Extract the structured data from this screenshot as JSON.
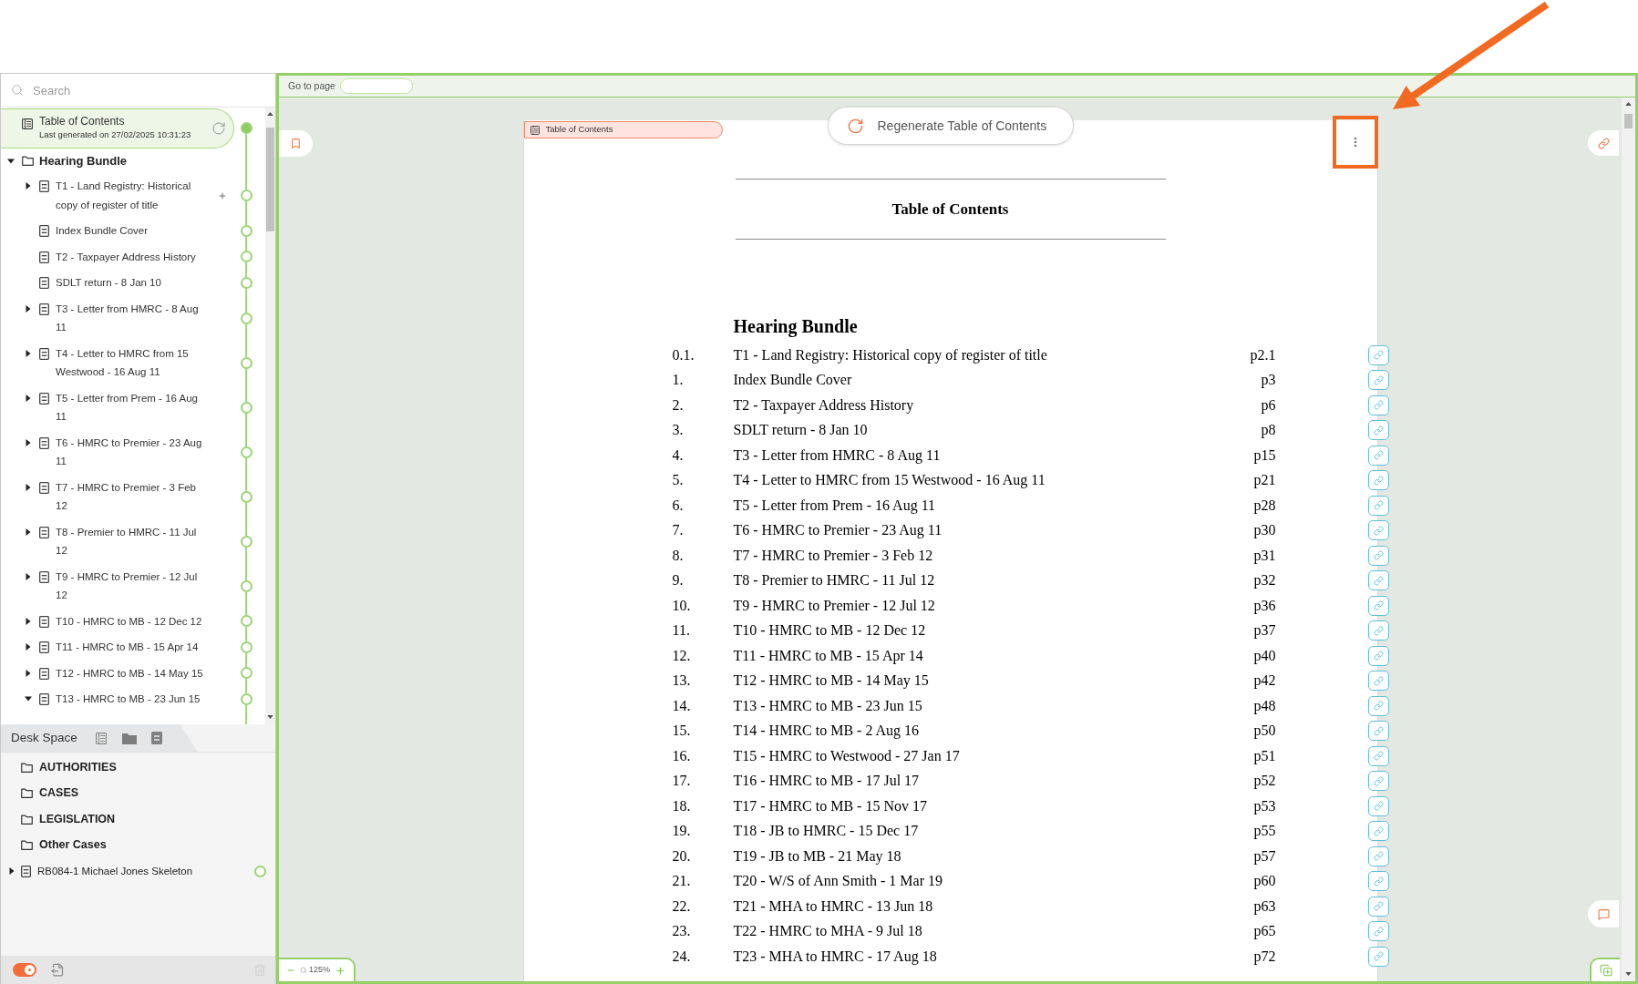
{
  "sidebar": {
    "search": {
      "placeholder": "Search"
    },
    "toc_entry": {
      "title": "Table of Contents",
      "subtitle": "Last generated on 27/02/2025 10:31:23",
      "selected": true
    },
    "tree": [
      {
        "label": "Hearing Bundle",
        "kind": "folder",
        "expanded": true,
        "children": [
          {
            "label": "T1 - Land Registry: Historical copy of register of title",
            "expandable": true,
            "expanded": false,
            "hovered": true
          },
          {
            "label": "Index Bundle Cover",
            "expandable": false,
            "hovered": false
          },
          {
            "label": "T2 - Taxpayer Address History",
            "expandable": false,
            "hovered": false
          },
          {
            "label": "SDLT return - 8 Jan 10",
            "expandable": false,
            "hovered": false
          },
          {
            "label": "T3 - Letter from HMRC - 8 Aug 11",
            "expandable": true,
            "expanded": false,
            "hovered": false
          },
          {
            "label": "T4 - Letter to HMRC from 15 Westwood - 16 Aug 11",
            "expandable": true,
            "expanded": false,
            "hovered": false
          },
          {
            "label": "T5 - Letter from Prem - 16 Aug 11",
            "expandable": true,
            "expanded": false,
            "hovered": false
          },
          {
            "label": "T6 - HMRC to Premier - 23 Aug 11",
            "expandable": true,
            "expanded": false,
            "hovered": false
          },
          {
            "label": "T7 - HMRC to Premier - 3 Feb 12",
            "expandable": true,
            "expanded": false,
            "hovered": false
          },
          {
            "label": "T8 - Premier to HMRC - 11 Jul 12",
            "expandable": true,
            "expanded": false,
            "hovered": false
          },
          {
            "label": "T9 - HMRC to Premier - 12 Jul 12",
            "expandable": true,
            "expanded": false,
            "hovered": false
          },
          {
            "label": "T10 - HMRC to MB - 12 Dec 12",
            "expandable": true,
            "expanded": false,
            "hovered": false
          },
          {
            "label": "T11 - HMRC to MB - 15 Apr 14",
            "expandable": true,
            "expanded": false,
            "hovered": false
          },
          {
            "label": "T12 - HMRC to MB - 14 May 15",
            "expandable": true,
            "expanded": false,
            "hovered": false
          },
          {
            "label": "T13 - HMRC to MB - 23 Jun 15",
            "expandable": true,
            "expanded": true,
            "hovered": false
          }
        ]
      }
    ],
    "desk_space": {
      "title": "Desk Space",
      "items": [
        {
          "label": "AUTHORITIES",
          "kind": "folder",
          "expandable": false
        },
        {
          "label": "CASES",
          "kind": "folder",
          "expandable": false
        },
        {
          "label": "LEGISLATION",
          "kind": "folder",
          "expandable": false
        },
        {
          "label": "Other Cases",
          "kind": "folder",
          "expandable": false
        },
        {
          "label": "RB084-1 Michael Jones Skeleton",
          "kind": "document",
          "expandable": true,
          "expanded": false
        }
      ]
    },
    "footer": {
      "toggle": {
        "on": true
      },
      "trash": {
        "disabled": true
      }
    }
  },
  "viewer": {
    "goto_page": {
      "label": "Go to page"
    },
    "document_tab": {
      "label": "Table of Contents"
    },
    "regenerate_button": {
      "label": "Regenerate Table of Contents"
    },
    "page": {
      "title": "Table of Contents",
      "section": "Hearing Bundle",
      "entries": [
        {
          "number": "0.1.",
          "title": "T1 - Land Registry: Historical copy of register of title",
          "page": "p2.1"
        },
        {
          "number": "1.",
          "title": "Index Bundle Cover",
          "page": "p3"
        },
        {
          "number": "2.",
          "title": "T2 - Taxpayer Address History",
          "page": "p6"
        },
        {
          "number": "3.",
          "title": "SDLT return - 8 Jan 10",
          "page": "p8"
        },
        {
          "number": "4.",
          "title": "T3 - Letter from HMRC - 8 Aug 11",
          "page": "p15"
        },
        {
          "number": "5.",
          "title": "T4 - Letter to HMRC from 15 Westwood - 16 Aug 11",
          "page": "p21"
        },
        {
          "number": "6.",
          "title": "T5 - Letter from Prem - 16 Aug 11",
          "page": "p28"
        },
        {
          "number": "7.",
          "title": "T6 - HMRC to Premier - 23 Aug 11",
          "page": "p30"
        },
        {
          "number": "8.",
          "title": "T7 - HMRC to Premier - 3 Feb 12",
          "page": "p31"
        },
        {
          "number": "9.",
          "title": "T8 - Premier to HMRC - 11 Jul 12",
          "page": "p32"
        },
        {
          "number": "10.",
          "title": "T9 - HMRC to Premier - 12 Jul 12",
          "page": "p36"
        },
        {
          "number": "11.",
          "title": "T10 - HMRC to MB - 12 Dec 12",
          "page": "p37"
        },
        {
          "number": "12.",
          "title": "T11 - HMRC to MB - 15 Apr 14",
          "page": "p40"
        },
        {
          "number": "13.",
          "title": "T12 - HMRC to MB - 14 May 15",
          "page": "p42"
        },
        {
          "number": "14.",
          "title": "T13 - HMRC to MB - 23 Jun 15",
          "page": "p48"
        },
        {
          "number": "15.",
          "title": "T14 - HMRC to MB - 2 Aug 16",
          "page": "p50"
        },
        {
          "number": "16.",
          "title": "T15 - HMRC to Westwood - 27 Jan 17",
          "page": "p51"
        },
        {
          "number": "17.",
          "title": "T16 - HMRC to MB - 17 Jul 17",
          "page": "p52"
        },
        {
          "number": "18.",
          "title": "T17 - HMRC to MB - 15 Nov 17",
          "page": "p53"
        },
        {
          "number": "19.",
          "title": "T18 - JB to HMRC - 15 Dec 17",
          "page": "p55"
        },
        {
          "number": "20.",
          "title": "T19 - JB to MB - 21 May 18",
          "page": "p57"
        },
        {
          "number": "21.",
          "title": "T20 - W/S of Ann Smith - 1 Mar 19",
          "page": "p60"
        },
        {
          "number": "22.",
          "title": "T21 - MHA to HMRC - 13 Jun 18",
          "page": "p63"
        },
        {
          "number": "23.",
          "title": "T22 - HMRC to MHA - 9 Jul 18",
          "page": "p65"
        },
        {
          "number": "24.",
          "title": "T23 - MHA to HMRC - 17 Aug 18",
          "page": "p72"
        }
      ]
    },
    "zoom": {
      "value": "125%"
    }
  }
}
